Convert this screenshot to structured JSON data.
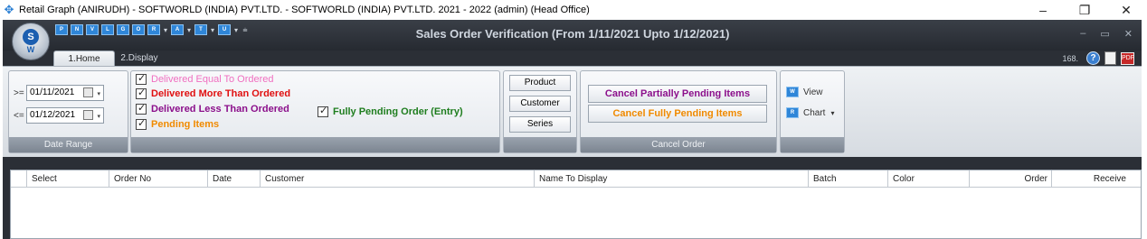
{
  "os_window": {
    "title": "Retail Graph (ANIRUDH) - SOFTWORLD (INDIA) PVT.LTD. - SOFTWORLD (INDIA) PVT.LTD.  2021 - 2022 (admin) (Head Office)",
    "minimize": "–",
    "restore": "❐",
    "close": "✕"
  },
  "app": {
    "orb_letter": "S",
    "orb_sub": "W",
    "title": "Sales Order Verification (From 1/11/2021 Upto 1/12/2021)",
    "qat_buttons": [
      "P",
      "N",
      "V",
      "L",
      "G",
      "O",
      "R",
      "A",
      "T",
      "U"
    ],
    "window_controls": [
      "–",
      "▭",
      "✕"
    ]
  },
  "tabs": [
    {
      "label": "1.Home",
      "active": true
    },
    {
      "label": "2.Display",
      "active": false
    }
  ],
  "status_counter": "168.",
  "date_range": {
    "label": "Date Range",
    "from_op": ">=",
    "from_value": "01/11/2021",
    "to_op": "<=",
    "to_value": "01/12/2021"
  },
  "filters": [
    {
      "label": "Delivered Equal To Ordered",
      "checked": true,
      "color": "#f06fc0"
    },
    {
      "label": "Delivered More Than Ordered",
      "checked": true,
      "color": "#e01010"
    },
    {
      "label": "Delivered Less Than Ordered",
      "checked": true,
      "color": "#8b0f8b"
    },
    {
      "label": "Pending Items",
      "checked": true,
      "color": "#f08a00"
    },
    {
      "label": "Fully Pending Order (Entry)",
      "checked": true,
      "color": "#1e7d1e"
    }
  ],
  "side_buttons": [
    "Product",
    "Customer",
    "Series"
  ],
  "cancel_order": {
    "label": "Cancel Order",
    "partial": "Cancel Partially Pending Items",
    "partial_color": "#8b0f8b",
    "fully": "Cancel Fully Pending Items",
    "fully_color": "#f08a00"
  },
  "view_group": {
    "view": "View",
    "chart": "Chart"
  },
  "grid": {
    "columns": [
      "Select",
      "Order No",
      "Date",
      "Customer",
      "Name To Display",
      "Batch",
      "Color",
      "Order",
      "Receive"
    ]
  }
}
